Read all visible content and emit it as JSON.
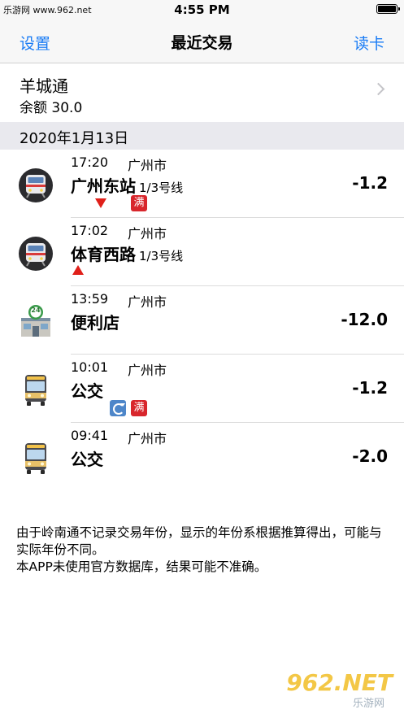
{
  "statusbar": {
    "carrier": "乐游网 www.962.net",
    "time": "4:55 PM"
  },
  "nav": {
    "left": "设置",
    "title": "最近交易",
    "right": "读卡"
  },
  "card": {
    "name": "羊城通",
    "balance": "余额 30.0"
  },
  "section": {
    "date": "2020年1月13日"
  },
  "transactions": [
    {
      "time": "17:20",
      "city": "广州市",
      "place": "广州东站",
      "line": "1/3号线",
      "amount": "-1.2",
      "icon": "metro-icon",
      "marks": [
        "direction-down",
        "full"
      ]
    },
    {
      "time": "17:02",
      "city": "广州市",
      "place": "体育西路",
      "line": "1/3号线",
      "amount": "",
      "icon": "metro-icon",
      "marks": [
        "direction-up"
      ]
    },
    {
      "time": "13:59",
      "city": "广州市",
      "place": "便利店",
      "line": "",
      "amount": "-12.0",
      "icon": "convenience-store-icon",
      "marks": []
    },
    {
      "time": "10:01",
      "city": "广州市",
      "place": "公交",
      "line": "",
      "amount": "-1.2",
      "icon": "bus-icon",
      "marks": [
        "transfer",
        "full"
      ]
    },
    {
      "time": "09:41",
      "city": "广州市",
      "place": "公交",
      "line": "",
      "amount": "-2.0",
      "icon": "bus-icon",
      "marks": []
    }
  ],
  "badges": {
    "full_label": "满",
    "store_hours": "24"
  },
  "footnote": {
    "line1": "由于岭南通不记录交易年份，显示的年份系根据推算得出，可能与实际年份不同。",
    "line2": "本APP未使用官方数据库，结果可能不准确。"
  },
  "watermark": {
    "main": "962.NET",
    "sub": "乐游网"
  },
  "colors": {
    "accent": "#1a7cf5",
    "mark_red": "#e0201a",
    "section_bg": "#e9e9ee"
  }
}
